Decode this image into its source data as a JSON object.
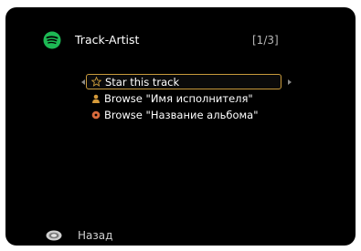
{
  "header": {
    "service_icon": "spotify-icon",
    "title": "Track-Artist",
    "page_indicator": "[1/3]"
  },
  "menu": {
    "items": [
      {
        "label": "Star this track",
        "icon": "star-icon",
        "selected": true
      },
      {
        "label": "Browse \"Имя исполнителя\"",
        "icon": "person-icon",
        "selected": false
      },
      {
        "label": "Browse \"Название альбома\"",
        "icon": "disc-icon",
        "selected": false
      }
    ]
  },
  "footer": {
    "icon": "return-button-icon",
    "back_label": "Назад"
  },
  "colors": {
    "background": "#000000",
    "highlight_border": "#c89a3c",
    "spotify_green": "#1db954",
    "text": "#ffffff",
    "dim_text": "#b8b8b8"
  }
}
